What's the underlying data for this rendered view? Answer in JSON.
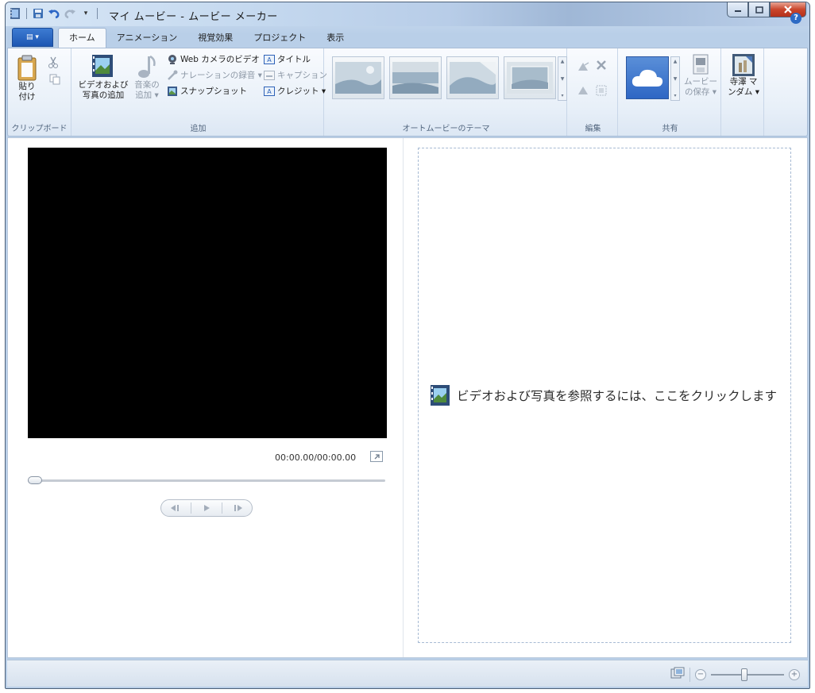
{
  "window": {
    "title": "マイ ムービー - ムービー メーカー"
  },
  "ribbon": {
    "app_button_label": "▤ ▾",
    "tabs": [
      "ホーム",
      "アニメーション",
      "視覚効果",
      "プロジェクト",
      "表示"
    ],
    "active_tab": "ホーム",
    "clipboard": {
      "group_label": "クリップボード",
      "paste_label_1": "貼り",
      "paste_label_2": "付け"
    },
    "add": {
      "group_label": "追加",
      "add_videos_label_1": "ビデオおよび",
      "add_videos_label_2": "写真の追加",
      "add_music_label_1": "音楽の",
      "add_music_label_2": "追加 ▾",
      "webcam_label": "Web カメラのビデオ",
      "narration_label": "ナレーションの録音 ▾",
      "snapshot_label": "スナップショット",
      "title_label": "タイトル",
      "caption_label": "キャプション",
      "credits_label": "クレジット ▾"
    },
    "themes": {
      "group_label": "オートムービーのテーマ"
    },
    "editing": {
      "group_label": "編集"
    },
    "share": {
      "group_label": "共有",
      "save_movie_label_1": "ムービー",
      "save_movie_label_2": "の保存 ▾"
    },
    "signin": {
      "label_1": "寺澤 マ",
      "label_2": "ンダム ▾"
    }
  },
  "preview": {
    "timecode": "00:00.00/00:00.00",
    "seek_position": 0
  },
  "storyboard": {
    "prompt": "ビデオおよび写真を参照するには、ここをクリックします"
  },
  "statusbar": {
    "zoom_minus": "−",
    "zoom_plus": "+",
    "zoom_level": 0.45
  },
  "colors": {
    "accent": "#1d57b3",
    "close_button": "#c9452b",
    "preview_bg": "#000000"
  }
}
